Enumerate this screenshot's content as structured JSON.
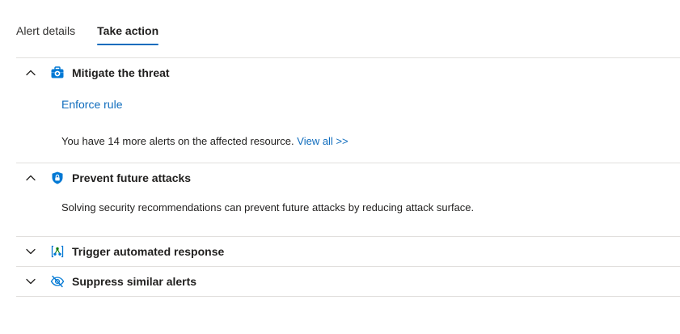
{
  "tabs": [
    {
      "label": "Alert details",
      "active": false
    },
    {
      "label": "Take action",
      "active": true
    }
  ],
  "sections": {
    "mitigate": {
      "title": "Mitigate the threat",
      "expanded": true,
      "icon": "medkit-icon",
      "enforce_link": "Enforce rule",
      "more_text": "You have 14 more alerts on the affected resource.",
      "view_all_link": "View all >>"
    },
    "prevent": {
      "title": "Prevent future attacks",
      "expanded": true,
      "icon": "shield-lock-icon",
      "description": "Solving security recommendations can prevent future attacks by reducing attack surface."
    },
    "trigger": {
      "title": "Trigger automated response",
      "expanded": false,
      "icon": "logic-app-icon"
    },
    "suppress": {
      "title": "Suppress similar alerts",
      "expanded": false,
      "icon": "eye-off-icon"
    }
  },
  "colors": {
    "accent": "#0f6cbd",
    "divider": "#e1dfdd",
    "icon_blue": "#0078d4"
  }
}
